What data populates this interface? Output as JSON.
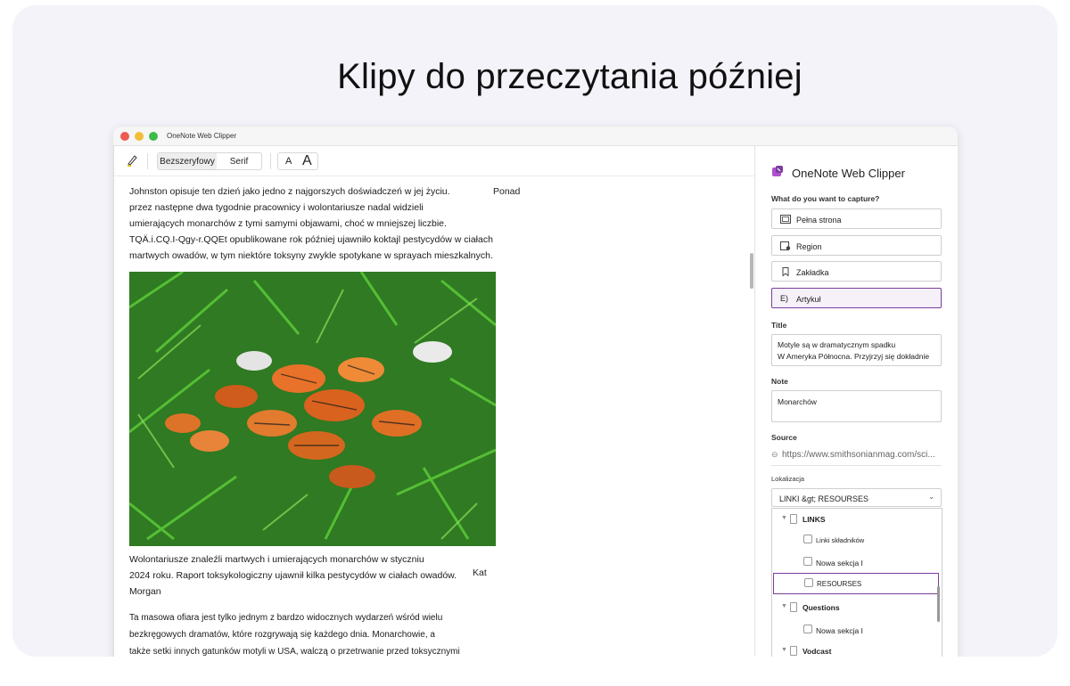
{
  "headline": "Klipy do przeczytania później",
  "window": {
    "title": "OneNote Web Clipper"
  },
  "toolbar": {
    "pen_icon": "highlighter-pen-icon",
    "font_sans": "Bezszeryfowy",
    "font_serif": "Serif",
    "size_small": "A",
    "size_large": "A"
  },
  "article": {
    "paragraph1_lines": [
      "Johnston opisuje ten dzień jako jedno z najgorszych doświadczeń w jej życiu.",
      "przez następne dwa tygodnie pracownicy i wolontariusze nadal widzieli",
      "umierających monarchów z tymi samymi objawami, choć w mniejszej liczbie.",
      "TQÄ.i.CQ.I-Qgy-r.QQEt opublikowane rok później ujawniło koktajl pestycydów w ciałach",
      "martwych owadów, w tym niektóre toksyny zwykle spotykane w sprayach mieszkalnych."
    ],
    "paragraph1_extra": "Ponad",
    "photo_alt": "monarch butterflies in grass",
    "caption_lines": [
      "Wolontariusze znaleźli martwych i umierających monarchów w styczniu",
      "2024 roku. Raport toksykologiczny ujawnił kilka pestycydów w ciałach owadów.",
      "Morgan"
    ],
    "caption_credit": "Kat",
    "paragraph3_lines": [
      "Ta masowa ofiara jest tylko jednym z bardzo widocznych wydarzeń wśród wielu",
      "bezkręgowych dramatów, które rozgrywają się każdego dnia. Monarchowie, a",
      "także setki innych gatunków motyli w USA, walczą o przetrwanie przed toksycznymi"
    ]
  },
  "panel": {
    "logo_icon": "onenote-clipper-icon",
    "title": "OneNote Web Clipper",
    "capture_label": "What do you want to capture?",
    "options": [
      {
        "label": "Pełna strona",
        "icon": "full-page-icon",
        "selected": false
      },
      {
        "label": "Region",
        "icon": "region-icon",
        "selected": false
      },
      {
        "label": "Zakładka",
        "icon": "bookmark-icon",
        "selected": false
      },
      {
        "label": "Artykuł",
        "icon": "article-icon",
        "prefix": "E)",
        "selected": true
      }
    ],
    "title_label": "Title",
    "title_lines": [
      "Motyle są w dramatycznym spadku",
      "W Ameryka Północna. Przyjrzyj się dokładnie"
    ],
    "note_label": "Note",
    "note_value": "Monarchów",
    "source_label": "Source",
    "source_value": "https://www.smithsonianmag.com/sci...",
    "location_label": "Lokalizacja",
    "location_value": "LINKI &gt; RESOURSES",
    "dropdown": [
      {
        "type": "notebook",
        "label": "LINKS"
      },
      {
        "type": "section",
        "label": "Linki składników"
      },
      {
        "type": "section",
        "label": "Nowa sekcja I"
      },
      {
        "type": "section",
        "label": "RESOURSES",
        "highlighted": true
      },
      {
        "type": "notebook",
        "label": "Questions"
      },
      {
        "type": "section",
        "label": "Nowa sekcja I"
      },
      {
        "type": "notebook",
        "label": "Vodcast"
      }
    ]
  },
  "colors": {
    "accent": "#7a3c9c",
    "card_bg": "#f3f3f9"
  }
}
